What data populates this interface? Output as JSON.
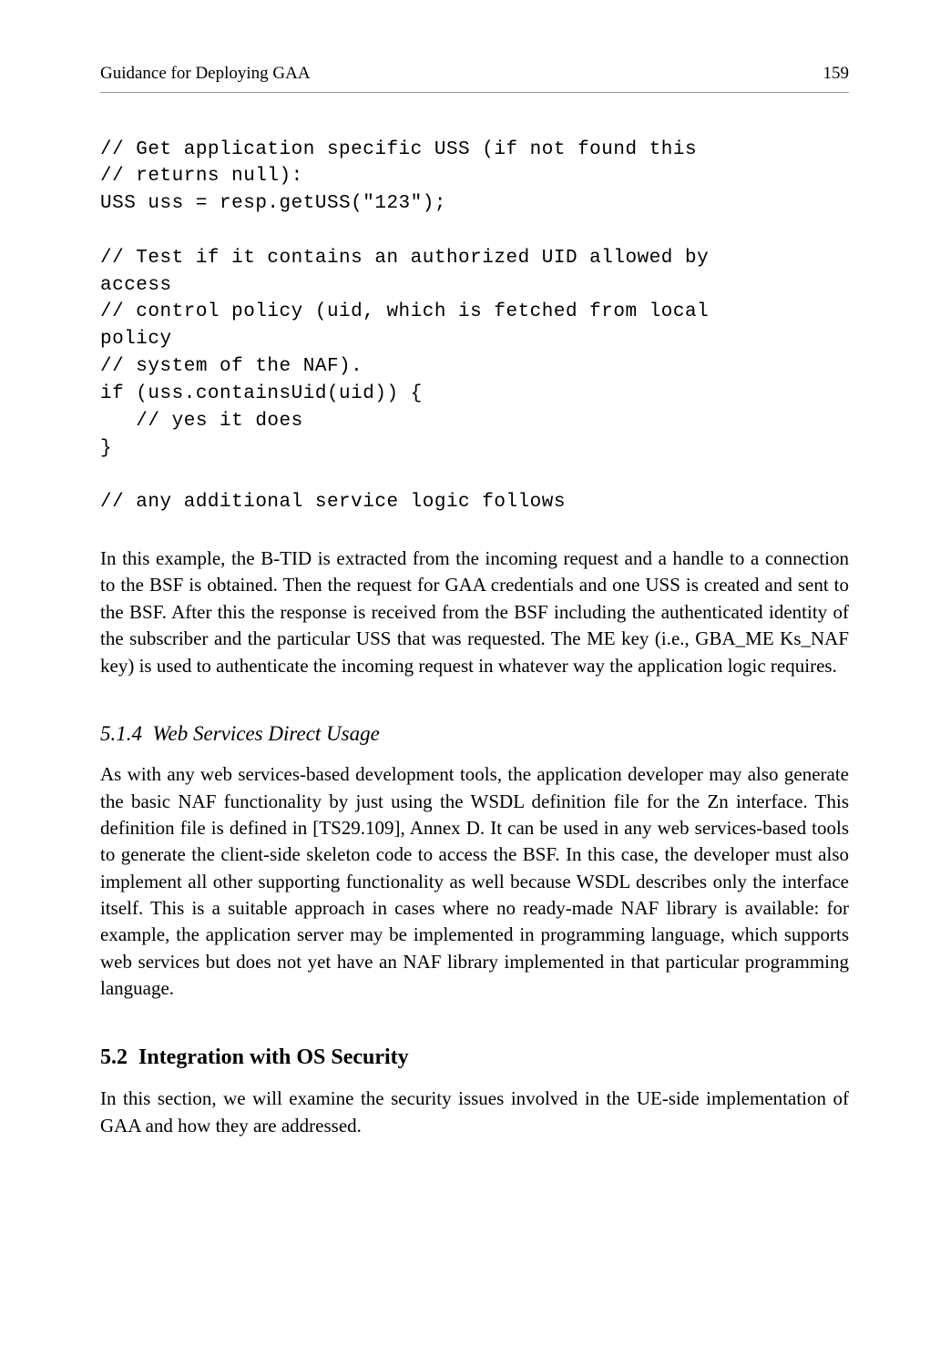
{
  "header": {
    "title": "Guidance for Deploying GAA",
    "page": "159"
  },
  "code": "// Get application specific USS (if not found this\n// returns null):\nUSS uss = resp.getUSS(\"123\");\n\n// Test if it contains an authorized UID allowed by\naccess\n// control policy (uid, which is fetched from local\npolicy\n// system of the NAF).\nif (uss.containsUid(uid)) {\n   // yes it does\n}\n\n// any additional service logic follows",
  "para1": "In this example, the B-TID is extracted from the incoming request and a handle to a connection to the BSF is obtained. Then the request for GAA credentials and one USS is created and sent to the BSF. After this the response is received from the BSF including the authenticated identity of the subscriber and the particular USS that was requested. The ME key (i.e., GBA_ME Ks_NAF key) is used to authenticate the incoming request in whatever way the application logic requires.",
  "subsection": {
    "number": "5.1.4",
    "title": "Web Services Direct Usage"
  },
  "para2": "As with any web services-based development tools, the application developer may also generate the basic NAF functionality by just using the WSDL definition file for the Zn interface. This definition file is defined in [TS29.109], Annex D. It can be used in any web services-based tools to generate the client-side skeleton code to access the BSF. In this case, the developer must also implement all other supporting functionality as well because WSDL describes only the interface itself. This is a suitable approach in cases where no ready-made NAF library is available: for example, the application server may be implemented in programming language, which supports web services but does not yet have an NAF library implemented in that particular programming language.",
  "section": {
    "number": "5.2",
    "title": "Integration with OS Security"
  },
  "para3": "In this section, we will examine the security issues involved in the UE-side implementation of GAA and how they are addressed."
}
